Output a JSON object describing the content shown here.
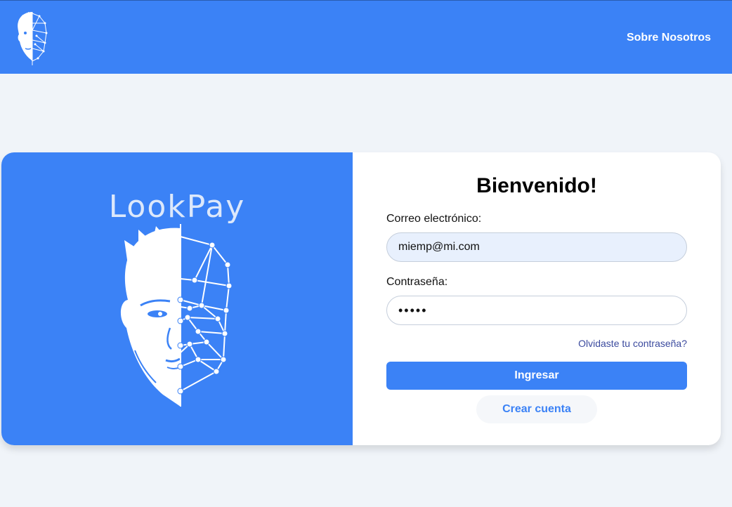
{
  "header": {
    "logo_icon": "face-scan-logo-icon",
    "nav_link": "Sobre Nosotros",
    "background": "#3b82f6"
  },
  "brand": {
    "name": "LookPay",
    "illustration": "face-scan-illustration"
  },
  "login": {
    "title": "Bienvenido!",
    "email_label": "Correo electrónico:",
    "email_value": "miemp@mi.com",
    "password_label": "Contraseña:",
    "password_value": "•••••",
    "forgot_link": "Olvidaste tu contraseña?",
    "submit_label": "Ingresar",
    "create_label": "Crear cuenta"
  },
  "colors": {
    "accent": "#3b82f6",
    "page_bg": "#f0f4f9",
    "link": "#3b4a9e"
  }
}
